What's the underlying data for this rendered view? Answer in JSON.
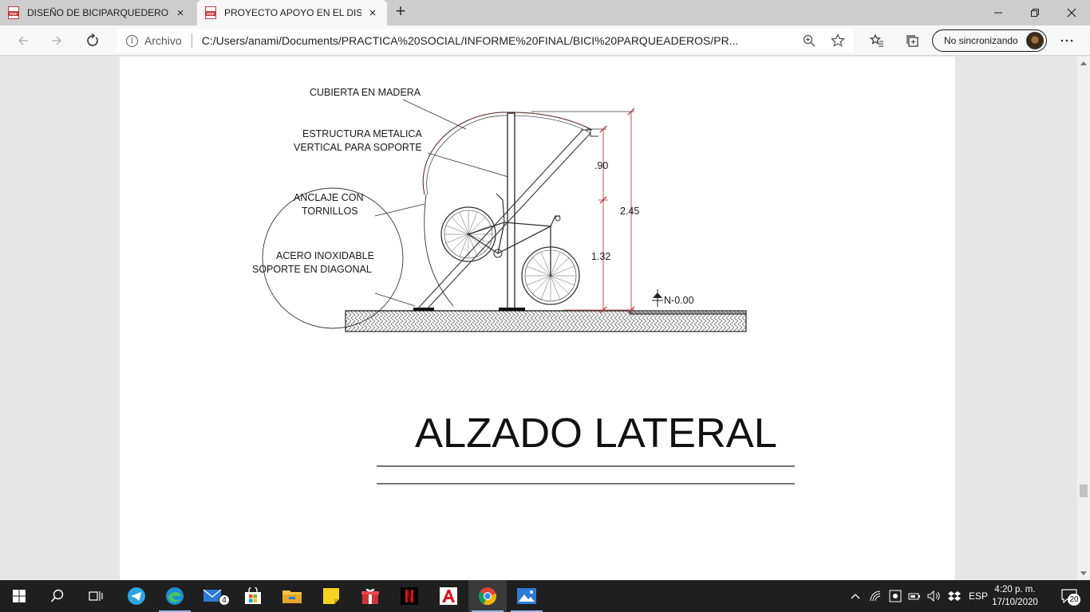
{
  "browser": {
    "tabs": [
      {
        "label": "DISEÑO DE BICIPARQUEDEROS D",
        "close": "×",
        "icon": "pdf-icon"
      },
      {
        "label": "PROYECTO APOYO EN EL DISEÑO",
        "close": "×",
        "icon": "pdf-icon"
      }
    ],
    "address": {
      "scheme": "Archivo",
      "url": "C:/Users/anami/Documents/PRACTICA%20SOCIAL/INFORME%20FINAL/BICI%20PARQUEADEROS/PR..."
    },
    "sync_label": "No sincronizando"
  },
  "drawing": {
    "labels": {
      "roof": "CUBIERTA EN MADERA",
      "structure_1": "ESTRUCTURA METALICA",
      "structure_2": "VERTICAL PARA SOPORTE",
      "anchor_1": "ANCLAJE CON",
      "anchor_2": "TORNILLOS",
      "steel_1": "ACERO INOXIDABLE",
      "steel_2": "SOPORTE EN DIAGONAL"
    },
    "dimensions": {
      "upper": ".90",
      "lower": "1.32",
      "total": "2.45",
      "level": "N-0.00"
    },
    "title": "ALZADO LATERAL"
  },
  "taskbar": {
    "apps": [
      "start-icon",
      "search-icon",
      "task-view-icon",
      "telegram-icon",
      "edge-icon",
      "mail-icon",
      "store-icon",
      "file-explorer-icon",
      "sticky-notes-icon",
      "gift-icon",
      "netflix-icon",
      "autocad-icon",
      "chrome-icon",
      "photos-icon"
    ],
    "mail_badge": "4",
    "tray": {
      "language": "ESP",
      "notifications": "20"
    },
    "clock": {
      "time": "4:20 p. m.",
      "date": "17/10/2020"
    }
  },
  "colors": {
    "accent_red": "#c23b3b",
    "tab_strip": "#cdcdcd",
    "taskbar": "#1f1f1f"
  }
}
